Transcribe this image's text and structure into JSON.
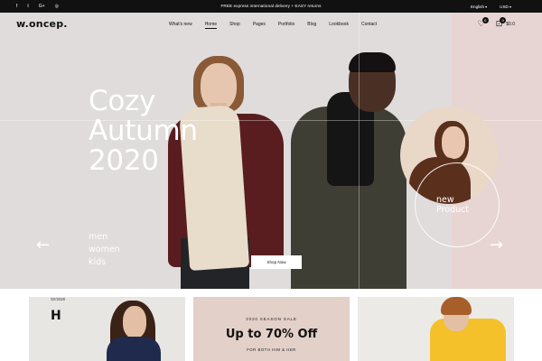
{
  "topbar": {
    "social": [
      "f",
      "t",
      "G+",
      "◎"
    ],
    "promo": "FREE express international delivery + EASY returns",
    "language": "English",
    "currency": "USD"
  },
  "nav": {
    "logo": "w.oncep.",
    "menu": [
      "What's new",
      "Home",
      "Shop",
      "Pages",
      "Portfolio",
      "Blog",
      "Lookbook",
      "Contact"
    ],
    "active_index": 1,
    "wishlist_count": "0",
    "cart_count": "0",
    "cart_total": "$0.0"
  },
  "hero": {
    "title_lines": [
      "Cozy",
      "Autumn",
      "2020"
    ],
    "categories": [
      "men",
      "women",
      "kids"
    ],
    "cta": "Shop Now",
    "new_product": [
      "new",
      "Product"
    ],
    "arrow_left": "←",
    "arrow_right": "→"
  },
  "cards": {
    "card1": {
      "small": "SS'2020",
      "big": "H"
    },
    "card2": {
      "label": "2020 SEASON SALE",
      "deal": "Up to 70% Off",
      "sub": "FOR BOTH HIM & HER"
    }
  },
  "colors": {
    "topbar": "#111111",
    "hero_bg": "#dfdcdb",
    "pink_panel": "#e7d5d3",
    "sale_card": "#e3d0c8"
  }
}
